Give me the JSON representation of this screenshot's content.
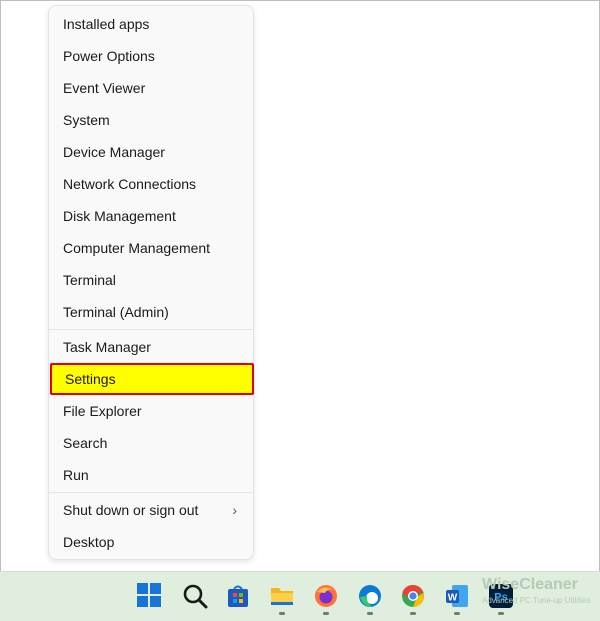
{
  "menu": {
    "group1": [
      "Installed apps",
      "Power Options",
      "Event Viewer",
      "System",
      "Device Manager",
      "Network Connections",
      "Disk Management",
      "Computer Management",
      "Terminal",
      "Terminal (Admin)"
    ],
    "group2": [
      "Task Manager",
      "Settings",
      "File Explorer",
      "Search",
      "Run"
    ],
    "group3": [
      "Shut down or sign out",
      "Desktop"
    ],
    "highlighted": "Settings",
    "submenu_arrow": "›",
    "highlight_color": "#ffff00",
    "highlight_border": "#e00000"
  },
  "taskbar": {
    "background": "#dfeedd",
    "icons": [
      "windows-start-icon",
      "search-icon",
      "microsoft-store-icon",
      "file-explorer-icon",
      "firefox-icon",
      "edge-icon",
      "chrome-icon",
      "word-icon",
      "photoshop-icon"
    ]
  },
  "watermark": {
    "title": "WiseCleaner",
    "subtitle": "Advanced PC Tune-up Utilities"
  }
}
